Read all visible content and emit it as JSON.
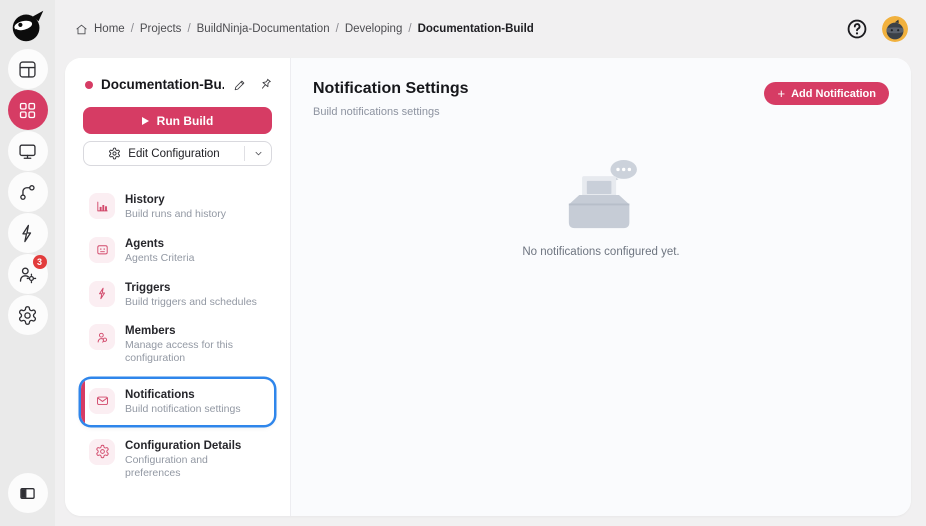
{
  "colors": {
    "accent_pink": "#d63c64",
    "icon_pink_bg": "#fbeef2",
    "selection_blue": "#2f86eb",
    "badge_red": "#e23c3c",
    "avatar_yellow": "#f1b13e"
  },
  "rail": {
    "logo_icon": "ninja-logo",
    "items": [
      {
        "icon": "dashboard-layout-icon",
        "active": false,
        "badge": ""
      },
      {
        "icon": "projects-grid-icon",
        "active": true,
        "badge": ""
      },
      {
        "icon": "monitor-icon",
        "active": false,
        "badge": ""
      },
      {
        "icon": "git-branch-icon",
        "active": false,
        "badge": ""
      },
      {
        "icon": "lightning-icon",
        "active": false,
        "badge": ""
      },
      {
        "icon": "user-settings-icon",
        "active": false,
        "badge": "3"
      },
      {
        "icon": "settings-gear-icon",
        "active": false,
        "badge": ""
      }
    ],
    "bottom_item": {
      "icon": "collapse-panel-icon"
    }
  },
  "topbar": {
    "breadcrumb": {
      "home_icon": "home-icon",
      "separator": "/",
      "items": [
        "Home",
        "Projects",
        "BuildNinja-Documentation",
        "Developing",
        "Documentation-Build"
      ]
    },
    "help_icon": "help-icon",
    "avatar_icon": "ninja-avatar"
  },
  "panel": {
    "title": "Documentation-Bu...",
    "edit_title_icon": "pencil-icon",
    "pin_icon": "pin-icon",
    "run_build": "Run Build",
    "edit_configuration": "Edit Configuration",
    "menu": [
      {
        "label": "History",
        "desc": "Build runs and history",
        "icon": "history-chart-icon"
      },
      {
        "label": "Agents",
        "desc": "Agents Criteria",
        "icon": "agent-bot-icon"
      },
      {
        "label": "Triggers",
        "desc": "Build triggers and schedules",
        "icon": "trigger-bolt-icon"
      },
      {
        "label": "Members",
        "desc": "Manage access for this configuration",
        "icon": "members-user-icon"
      },
      {
        "label": "Notifications",
        "desc": "Build notification settings",
        "icon": "envelope-icon",
        "selected": true
      },
      {
        "label": "Configuration Details",
        "desc": "Configuration and preferences",
        "icon": "config-gear-icon"
      }
    ]
  },
  "main": {
    "title": "Notification Settings",
    "subtitle": "Build notifications settings",
    "plus": "+",
    "add_button": "Add Notification",
    "empty_icon": "empty-inbox-icon",
    "empty_message": "No notifications configured yet."
  }
}
